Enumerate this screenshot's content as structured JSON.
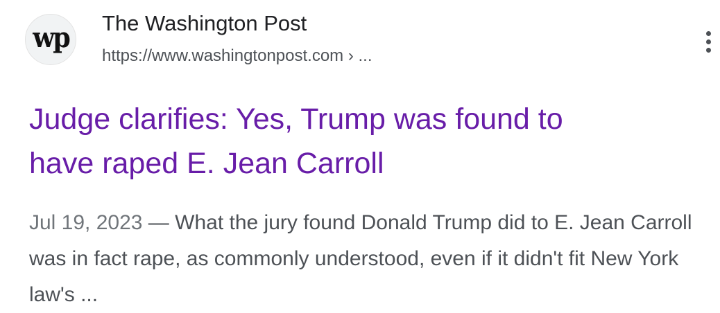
{
  "result": {
    "favicon_text": "wp",
    "site_name": "The Washington Post",
    "url": "https://www.washingtonpost.com › ...",
    "title_line1": "Judge clarifies: Yes, Trump was found to",
    "title_line2": "have raped E. Jean Carroll",
    "date": "Jul 19, 2023",
    "separator": " — ",
    "snippet": "What the jury found Donald Trump did to E. Jean Carroll was in fact rape, as commonly understood, even if it didn't fit New York law's ..."
  },
  "icons": {
    "favicon": "washington-post-logo",
    "more": "more-vert-icon"
  },
  "colors": {
    "title_visited": "#681da8",
    "site_name": "#202124",
    "url": "#4d5156",
    "snippet": "#4d5156"
  }
}
